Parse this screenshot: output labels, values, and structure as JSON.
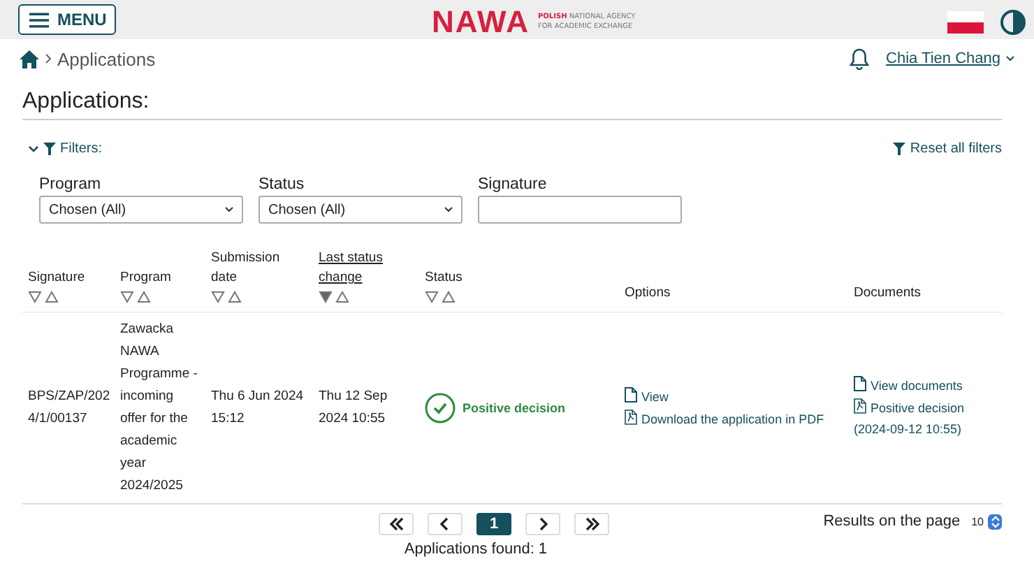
{
  "header": {
    "menu_label": "MENU",
    "logo_text": "NAWA",
    "agency_lines": [
      {
        "bold": "POLISH",
        "rest": " NATIONAL AGENCY"
      },
      {
        "rest": "FOR ACADEMIC EXCHANGE"
      }
    ]
  },
  "breadcrumb": [
    "Applications"
  ],
  "user": {
    "name": "Chia Tien Chang"
  },
  "page_title": "Applications:",
  "filters": {
    "toggle_label": "Filters:",
    "expanded": true,
    "reset_label": "Reset all filters",
    "fields": [
      {
        "kind": "select",
        "label": "Program",
        "value": "Chosen (All)"
      },
      {
        "kind": "select",
        "label": "Status",
        "value": "Chosen (All)"
      },
      {
        "kind": "text",
        "label": "Signature"
      }
    ]
  },
  "table": {
    "columns": [
      {
        "label": "Signature",
        "sort_active": false
      },
      {
        "label": "Program",
        "sort_active": false
      },
      {
        "label": "Submission date",
        "sort_active": false
      },
      {
        "label": "Last status change",
        "sort_active": true
      },
      {
        "label": "Status",
        "sort_active": false
      },
      {
        "label": "Options"
      },
      {
        "label": "Documents"
      }
    ],
    "rows": [
      {
        "signature": "BPS/ZAP/2024/1/00137",
        "program": "Zawacka NAWA Programme - incoming offer for the academic year 2024/2025",
        "submission_date": "Thu 6 Jun 2024 15:12",
        "last_status_change": "Thu 12 Sep 2024 10:55",
        "status": {
          "kind": "positive",
          "label": "Positive decision"
        },
        "options": [
          {
            "kind": "doc",
            "label": "View"
          },
          {
            "kind": "pdf",
            "label": "Download the application in PDF"
          }
        ],
        "documents": [
          {
            "kind": "doc",
            "label": "View documents"
          },
          {
            "kind": "pdf",
            "label": "Positive decision (2024-09-12 10:55)"
          }
        ]
      }
    ]
  },
  "pagination": {
    "buttons": [
      {
        "kind": "first",
        "selected": false
      },
      {
        "kind": "prev",
        "selected": false
      },
      {
        "kind": "page",
        "label": "1",
        "selected": true
      },
      {
        "kind": "next",
        "selected": false
      },
      {
        "kind": "last",
        "selected": false
      }
    ],
    "found": "Applications found: 1",
    "per_page_label": "Results on the page",
    "per_page": "10"
  }
}
